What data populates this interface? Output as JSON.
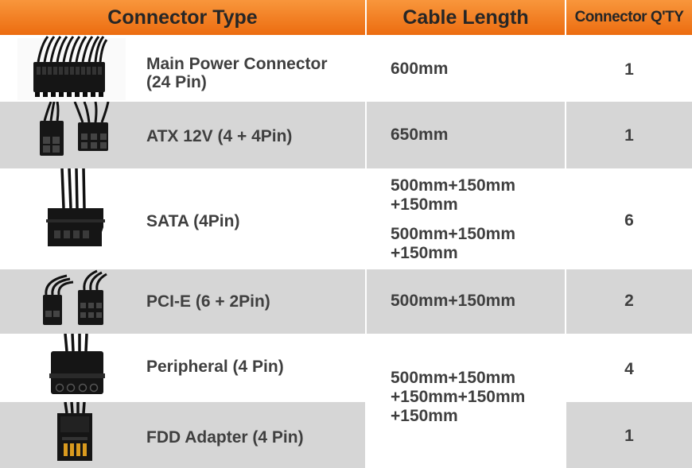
{
  "header": {
    "connector_type": "Connector Type",
    "cable_length": "Cable Length",
    "connector_qty": "Connector Q'TY"
  },
  "rows": [
    {
      "name_line1": "Main Power Connector",
      "name_line2": "(24 Pin)",
      "length": "600mm",
      "qty": "1",
      "icon": "24-pin-connector-icon"
    },
    {
      "name": "ATX 12V (4 + 4Pin)",
      "length": "650mm",
      "qty": "1",
      "icon": "atx-12v-connector-icon"
    },
    {
      "name": "SATA (4Pin)",
      "length_a_line1": "500mm+150mm",
      "length_a_line2": "+150mm",
      "length_b_line1": "500mm+150mm",
      "length_b_line2": "+150mm",
      "qty": "6",
      "icon": "sata-connector-icon"
    },
    {
      "name": "PCI-E (6 + 2Pin)",
      "length": "500mm+150mm",
      "qty": "2",
      "icon": "pci-e-connector-icon"
    },
    {
      "name": "Peripheral (4 Pin)",
      "qty": "4",
      "icon": "peripheral-connector-icon"
    },
    {
      "name": "FDD Adapter (4 Pin)",
      "qty": "1",
      "icon": "fdd-connector-icon"
    }
  ],
  "shared_length": {
    "line1": "500mm+150mm",
    "line2": "+150mm+150mm",
    "line3": "+150mm"
  },
  "colors": {
    "header": "#f28a2e",
    "row_gray": "#d6d6d6",
    "row_white": "#ffffff",
    "text": "#3f3f3f"
  }
}
